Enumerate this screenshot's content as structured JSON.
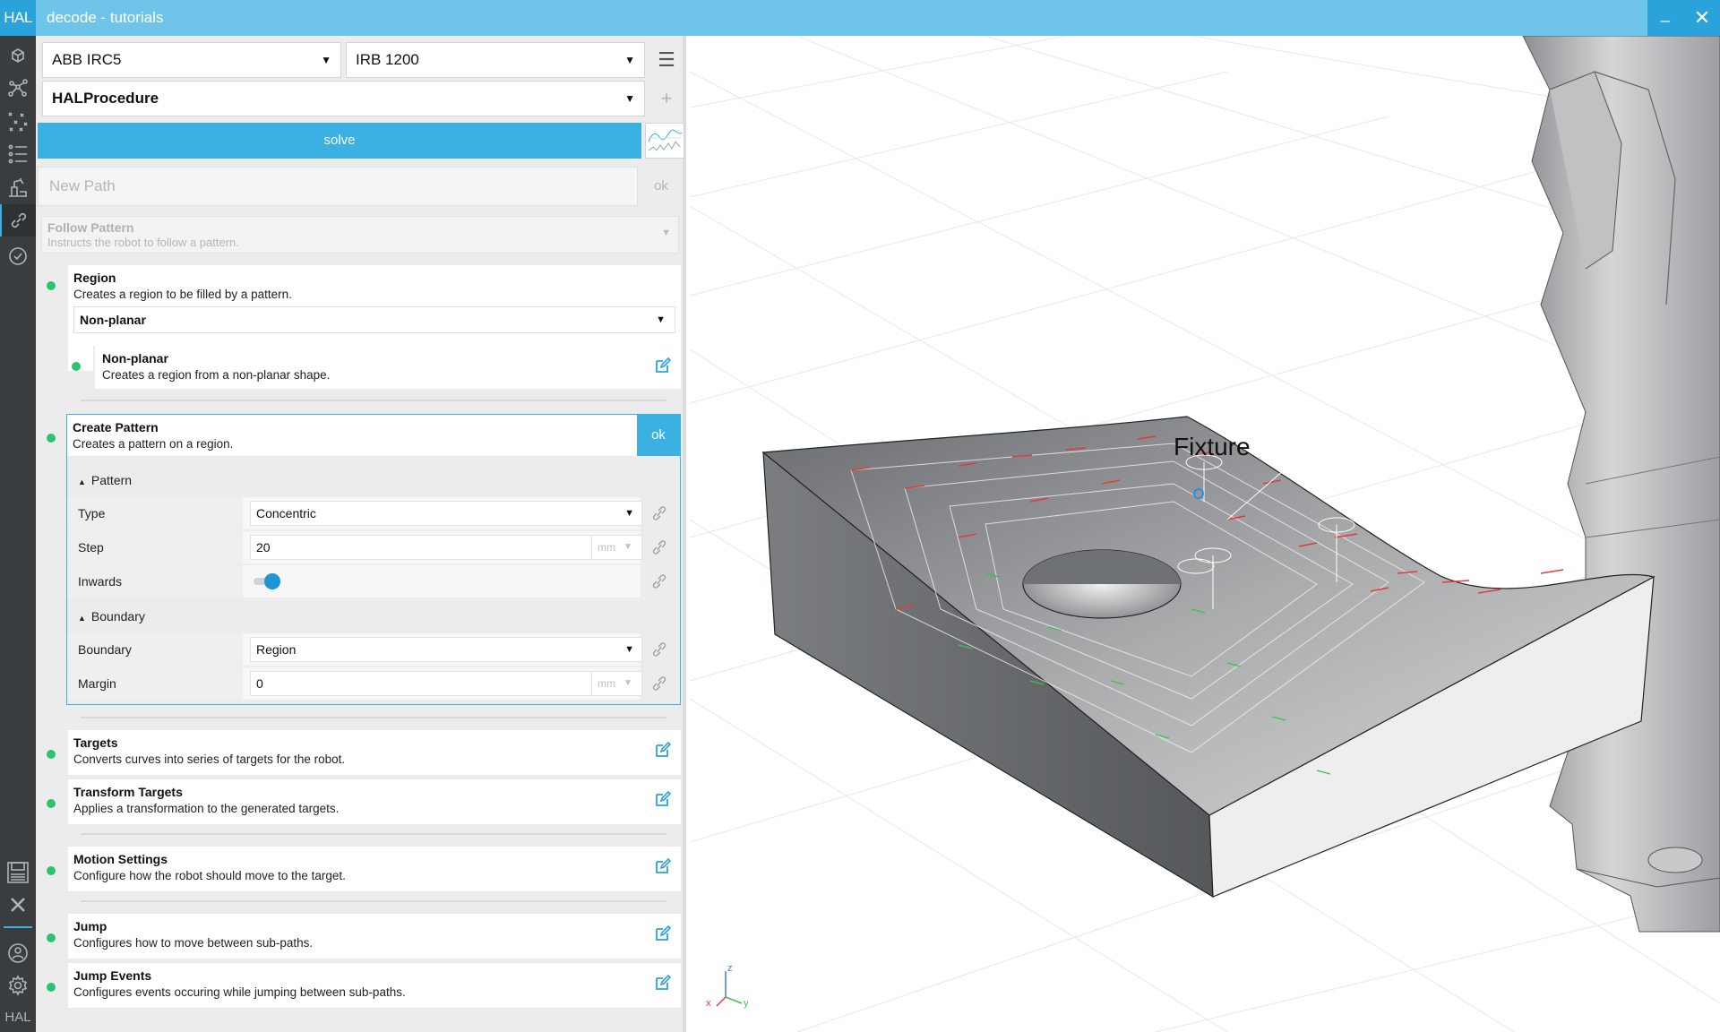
{
  "window": {
    "logo": "HAL",
    "title": "decode - tutorials",
    "minimize": "_",
    "close": "✕"
  },
  "rail": {
    "bottom_logo": "HAL"
  },
  "toolbar": {
    "controller": "ABB IRC5",
    "robot": "IRB 1200",
    "procedure": "HALProcedure",
    "solve_label": "solve"
  },
  "new_path": {
    "placeholder": "New Path",
    "ok_label": "ok"
  },
  "follow_pattern": {
    "title": "Follow Pattern",
    "description": "Instructs the robot to follow a pattern."
  },
  "region": {
    "title": "Region",
    "description": "Creates a region to be filled by a pattern.",
    "selected": "Non-planar",
    "child": {
      "title": "Non-planar",
      "description": "Creates a region from a non-planar shape."
    }
  },
  "create_pattern": {
    "title": "Create Pattern",
    "description": "Creates a pattern on a region.",
    "ok_label": "ok",
    "pattern_section": "Pattern",
    "boundary_section": "Boundary",
    "fields": {
      "type_label": "Type",
      "type_value": "Concentric",
      "step_label": "Step",
      "step_value": "20",
      "step_unit": "mm",
      "inwards_label": "Inwards",
      "inwards_on": true,
      "boundary_label": "Boundary",
      "boundary_value": "Region",
      "margin_label": "Margin",
      "margin_value": "0",
      "margin_unit": "mm"
    }
  },
  "steps": [
    {
      "title": "Targets",
      "description": "Converts curves into series of targets for the robot."
    },
    {
      "title": "Transform Targets",
      "description": "Applies a transformation to the generated targets."
    },
    {
      "title": "Motion Settings",
      "description": "Configure how the robot should move to the target."
    },
    {
      "title": "Jump",
      "description": "Configures how to move between sub-paths."
    },
    {
      "title": "Jump Events",
      "description": "Configures events occuring while jumping between sub-paths."
    }
  ],
  "viewport": {
    "part_label": "Fixture",
    "axis_x": "x",
    "axis_y": "y",
    "axis_z": "z"
  },
  "colors": {
    "accent": "#3bb0e2",
    "titlebar": "#6fc4ea",
    "status_ok": "#2dc26e",
    "rail": "#3a3d40"
  }
}
